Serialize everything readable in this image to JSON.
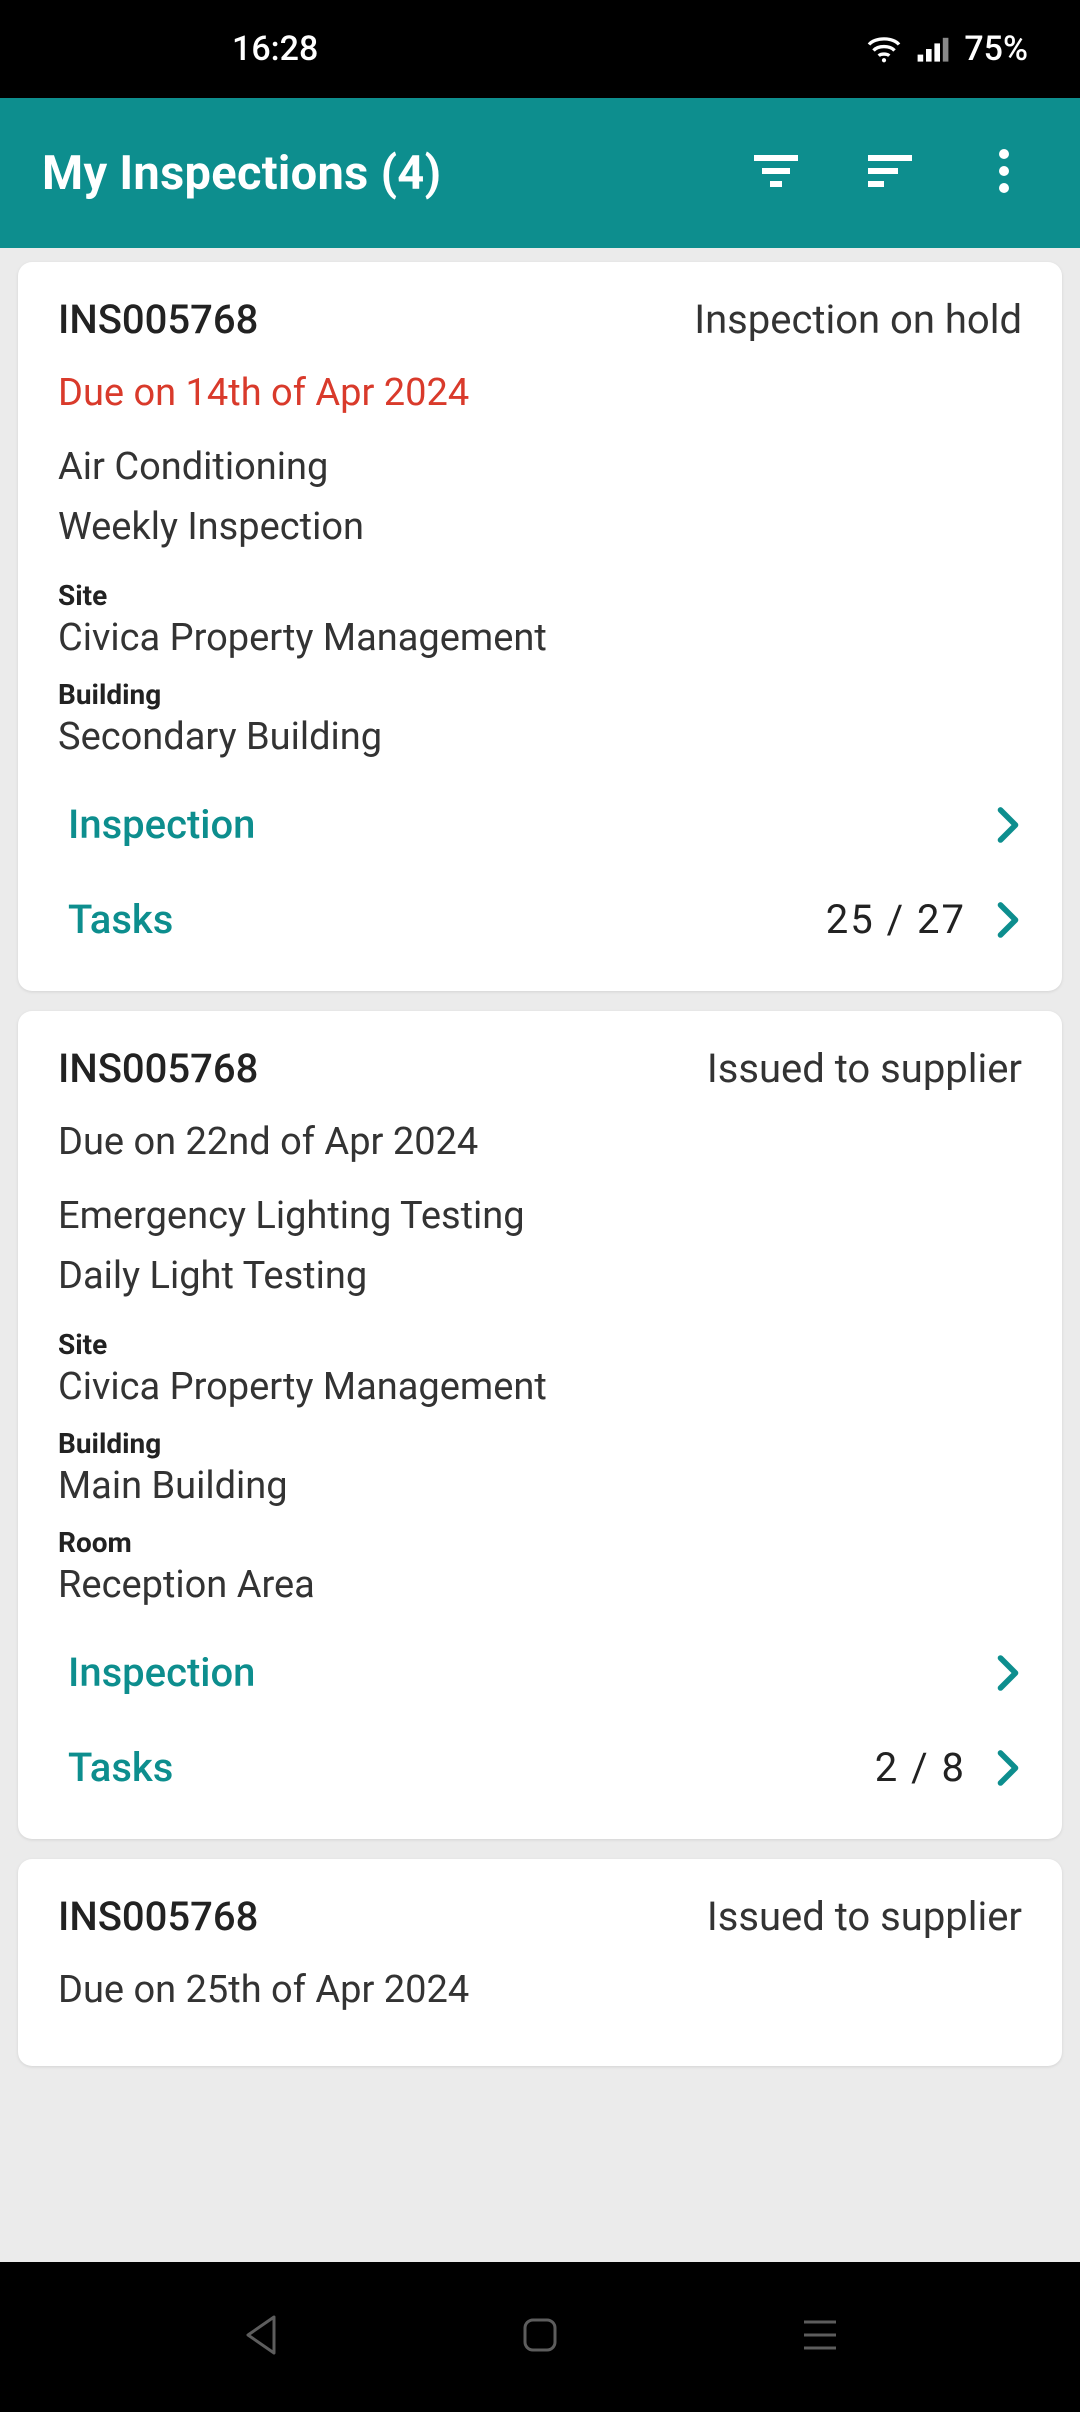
{
  "status_bar": {
    "time": "16:28",
    "battery": "75%"
  },
  "app_bar": {
    "title": "My Inspections (4)"
  },
  "labels": {
    "site": "Site",
    "building": "Building",
    "room": "Room",
    "inspection": "Inspection",
    "tasks": "Tasks"
  },
  "cards": [
    {
      "id": "INS005768",
      "status": "Inspection on hold",
      "due": "Due on 14th of Apr 2024",
      "overdue": true,
      "category": "Air Conditioning",
      "schedule": "Weekly Inspection",
      "site": "Civica Property Management",
      "building": "Secondary Building",
      "room": null,
      "tasks": "25 / 27"
    },
    {
      "id": "INS005768",
      "status": "Issued to supplier",
      "due": "Due on 22nd of Apr 2024",
      "overdue": false,
      "category": "Emergency Lighting Testing",
      "schedule": "Daily Light Testing",
      "site": "Civica Property Management",
      "building": "Main Building",
      "room": "Reception Area",
      "tasks": "2 / 8"
    },
    {
      "id": "INS005768",
      "status": "Issued to supplier",
      "due": "Due on 25th of Apr 2024",
      "overdue": false,
      "category": null,
      "schedule": null,
      "site": null,
      "building": null,
      "room": null,
      "tasks": null
    }
  ],
  "colors": {
    "accent": "#0d8e8e",
    "overdue": "#d93a2b"
  }
}
